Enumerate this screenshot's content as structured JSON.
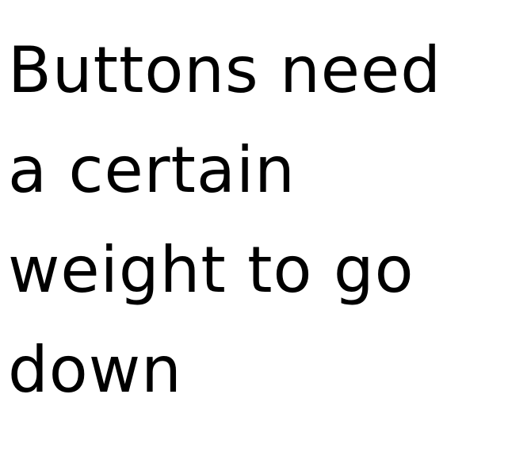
{
  "text_lines": [
    "Buttons need",
    "a certain",
    "weight to go",
    "down"
  ],
  "colors": {
    "background": "#ffffff",
    "text": "#000000"
  }
}
